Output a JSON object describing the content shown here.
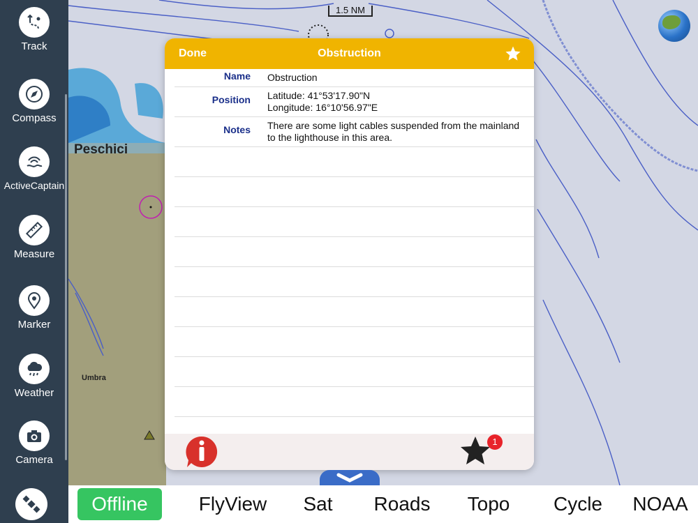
{
  "sidebar": {
    "items": [
      {
        "label": "Track",
        "icon": "track-icon"
      },
      {
        "label": "Compass",
        "icon": "compass-icon"
      },
      {
        "label": "ActiveCaptain",
        "icon": "activecaptain-icon"
      },
      {
        "label": "Measure",
        "icon": "ruler-icon"
      },
      {
        "label": "Marker",
        "icon": "map-pin-icon"
      },
      {
        "label": "Weather",
        "icon": "rain-cloud-icon"
      },
      {
        "label": "Camera",
        "icon": "camera-icon"
      },
      {
        "label": "",
        "icon": "satellite-icon"
      }
    ]
  },
  "map": {
    "scale_label": "1.5 NM",
    "place_peschici": "Peschici",
    "place_umbra": "Umbra"
  },
  "dialog": {
    "done_label": "Done",
    "title": "Obstruction",
    "fields": {
      "name_key": "Name",
      "name_value": "Obstruction",
      "position_key": "Position",
      "latitude": "Latitude: 41°53'17.90\"N",
      "longitude": "Longitude: 16°10'56.97\"E",
      "notes_key": "Notes",
      "notes_value": "There are some light cables suspended from the mainland to the lighthouse in this area."
    },
    "footer": {
      "favorites_badge": "1"
    },
    "colors": {
      "header": "#f0b400",
      "key_text": "#1a2f8a"
    }
  },
  "bottombar": {
    "tabs": [
      "Offline",
      "FlyView",
      "Sat",
      "Roads",
      "Topo",
      "Cycle",
      "NOAA"
    ],
    "active": "Offline",
    "active_color": "#36c561"
  }
}
